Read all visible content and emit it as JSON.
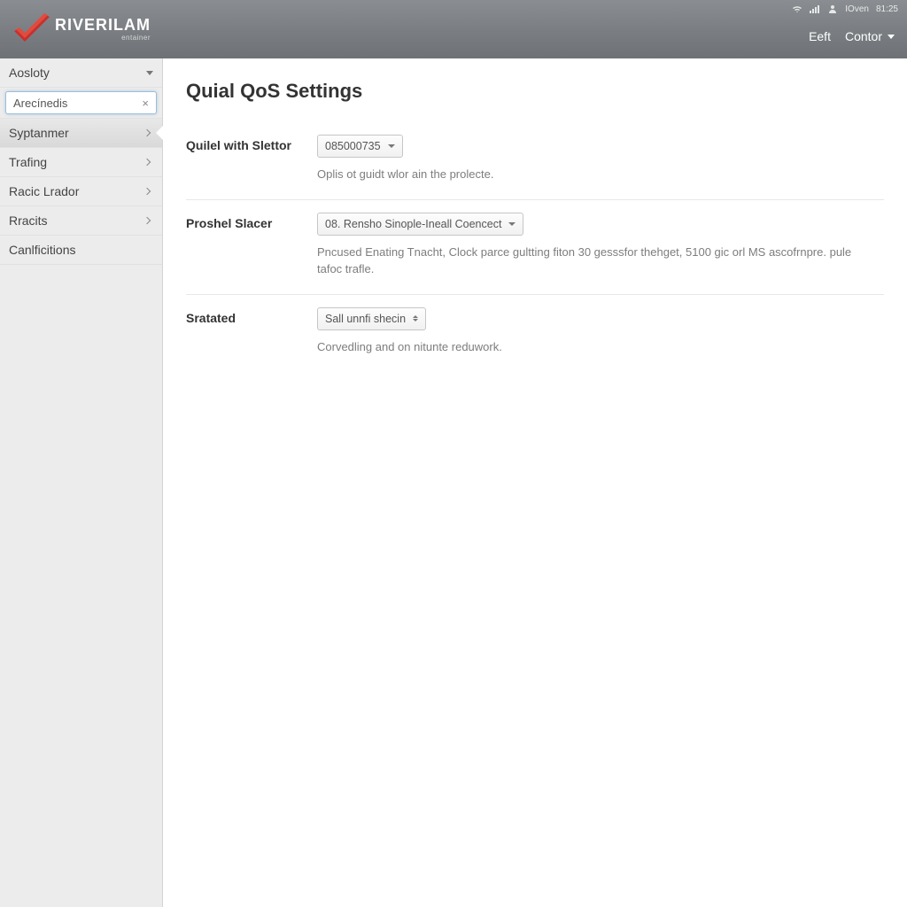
{
  "statusbar": {
    "user_label": "IOven",
    "time": "81:25"
  },
  "brand": {
    "name": "RIVERILAM",
    "subtitle": "entainer"
  },
  "header": {
    "edit_label": "Eeft",
    "control_label": "Contor"
  },
  "sidebar": {
    "top_item": "Aosloty",
    "search_value": "Arecínedis",
    "items": [
      {
        "label": "Syptanmer",
        "active": true
      },
      {
        "label": "Trafing",
        "active": false
      },
      {
        "label": "Racic Lrador",
        "active": false
      },
      {
        "label": "Rracits",
        "active": false
      }
    ],
    "last_item": "Canlficitions"
  },
  "page": {
    "title": "Quial QoS Settings",
    "rows": [
      {
        "label": "Quilel with Slettor",
        "select_value": "085000735",
        "caret": "single",
        "help": "Oplis ot guidt wlor ain the prolecte."
      },
      {
        "label": "Proshel Slacer",
        "select_value": "08. Rensho Sinople-Ineall Coencect",
        "caret": "single",
        "help": "Pncused Enating Tnacht, Clock parce gultting fiton 30 gesssfor thehget, 5100 gic orl MS ascofrnpre. pule tafoc trafle."
      },
      {
        "label": "Sratated",
        "select_value": "Sall unnfi shecin",
        "caret": "sort",
        "help": "Corvedling and on nitunte reduwork."
      }
    ]
  }
}
